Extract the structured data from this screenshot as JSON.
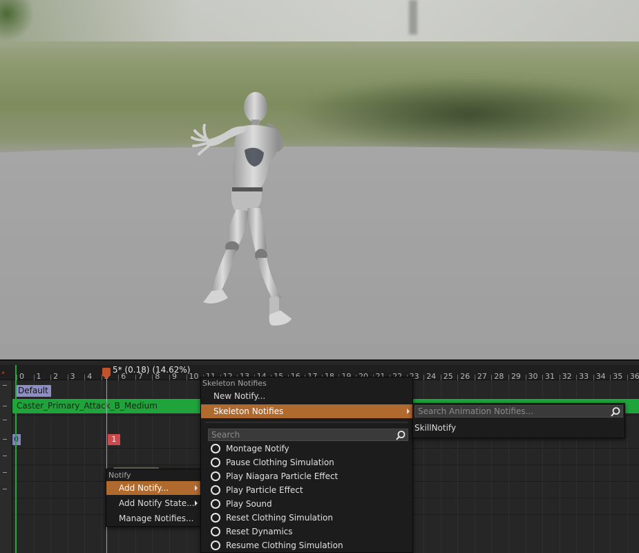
{
  "timeline": {
    "scrub_readout": "5* (0.18) (14.62%)",
    "start_marker": "*",
    "ticks": [
      "0",
      "1",
      "2",
      "3",
      "4",
      "5",
      "6",
      "7",
      "8",
      "9",
      "10",
      "11",
      "12",
      "13",
      "14",
      "15",
      "16",
      "17",
      "18",
      "19",
      "20",
      "21",
      "22",
      "23",
      "24",
      "25",
      "26",
      "27",
      "28",
      "29",
      "30",
      "31",
      "32",
      "33",
      "34",
      "35",
      "36"
    ],
    "section_label": "Default",
    "anim_track_label": "Caster_Primary_Attack_B_Medium",
    "notify_marker_0": "0",
    "notify_marker_1": "1"
  },
  "notify_menu": {
    "heading": "Notify",
    "items": [
      {
        "label": "Add Notify...",
        "highlighted": true,
        "has_submenu": true
      },
      {
        "label": "Add Notify State...",
        "highlighted": false,
        "has_submenu": true
      },
      {
        "label": "Manage Notifies...",
        "highlighted": false,
        "has_submenu": false
      }
    ]
  },
  "add_notify_menu": {
    "heading": "Skeleton Notifies",
    "new_notify": "New Notify...",
    "skeleton_notifies": "Skeleton Notifies",
    "search_placeholder": "Search",
    "notifies": [
      "Montage Notify",
      "Pause Clothing Simulation",
      "Play Niagara Particle Effect",
      "Play Particle Effect",
      "Play Sound",
      "Reset Clothing Simulation",
      "Reset Dynamics",
      "Resume Clothing Simulation"
    ]
  },
  "skeleton_notifies_menu": {
    "search_placeholder": "Search Animation Notifies...",
    "items": [
      "SkillNotify"
    ]
  },
  "colors": {
    "highlight": "#b06a2e",
    "anim_track": "#1fa33b",
    "section": "#8e8ec7",
    "notify_marker": "#c94b4b"
  }
}
